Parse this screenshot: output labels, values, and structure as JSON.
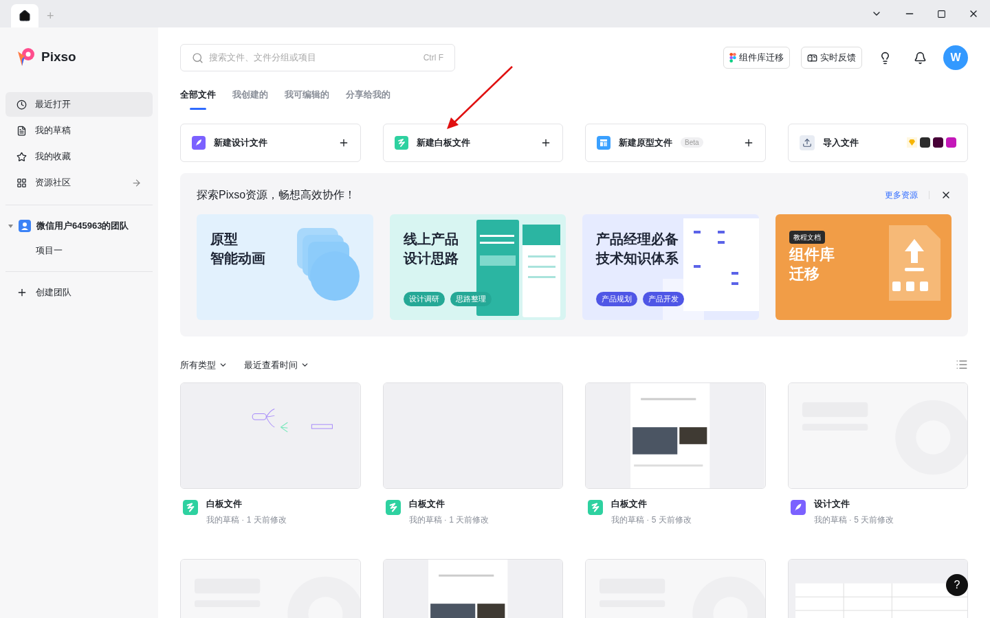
{
  "title_bar": {
    "new_tab": "+"
  },
  "sidebar": {
    "brand": "Pixso",
    "items": [
      {
        "label": "最近打开",
        "selected": true
      },
      {
        "label": "我的草稿",
        "selected": false
      },
      {
        "label": "我的收藏",
        "selected": false
      },
      {
        "label": "资源社区",
        "selected": false
      }
    ],
    "team": {
      "name": "微信用户645963的团队",
      "expanded": true,
      "projects": [
        "项目一"
      ]
    },
    "create_team": "创建团队"
  },
  "search": {
    "placeholder": "搜索文件、文件分组或项目",
    "shortcut": "Ctrl F"
  },
  "header_buttons": [
    "组件库迁移",
    "实时反馈"
  ],
  "avatar": "W",
  "tabs": [
    {
      "label": "全部文件",
      "selected": true
    },
    {
      "label": "我创建的",
      "selected": false
    },
    {
      "label": "我可编辑的",
      "selected": false
    },
    {
      "label": "分享给我的",
      "selected": false
    }
  ],
  "create_cards": [
    {
      "label": "新建设计文件",
      "kind": "design"
    },
    {
      "label": "新建白板文件",
      "kind": "whiteboard"
    },
    {
      "label": "新建原型文件",
      "kind": "prototype",
      "badge": "Beta"
    },
    {
      "label": "导入文件",
      "kind": "import"
    }
  ],
  "resources": {
    "title": "探索Pixso资源，畅想高效协作！",
    "more": "更多资源",
    "banners": [
      {
        "kind": "animation",
        "lines": [
          "原型",
          "智能动画"
        ]
      },
      {
        "kind": "thinking",
        "lines": [
          "线上产品",
          "设计思路"
        ],
        "tags": [
          "设计调研",
          "思路整理"
        ]
      },
      {
        "kind": "knowledge",
        "lines": [
          "产品经理必备",
          "技术知识体系"
        ],
        "tags": [
          "产品规划",
          "产品开发"
        ]
      },
      {
        "kind": "migrate",
        "badge": "教程文档",
        "lines": [
          "组件库",
          "迁移"
        ]
      }
    ]
  },
  "filters": [
    "所有类型",
    "最近查看时间"
  ],
  "files": [
    {
      "name": "白板文件",
      "kind": "whiteboard",
      "meta": "我的草稿 · 1 天前修改"
    },
    {
      "name": "白板文件",
      "kind": "whiteboard",
      "meta": "我的草稿 · 1 天前修改"
    },
    {
      "name": "白板文件",
      "kind": "whiteboard",
      "meta": "我的草稿 · 5 天前修改"
    },
    {
      "name": "设计文件",
      "kind": "design",
      "meta": "我的草稿 · 5 天前修改"
    }
  ],
  "help": "?"
}
